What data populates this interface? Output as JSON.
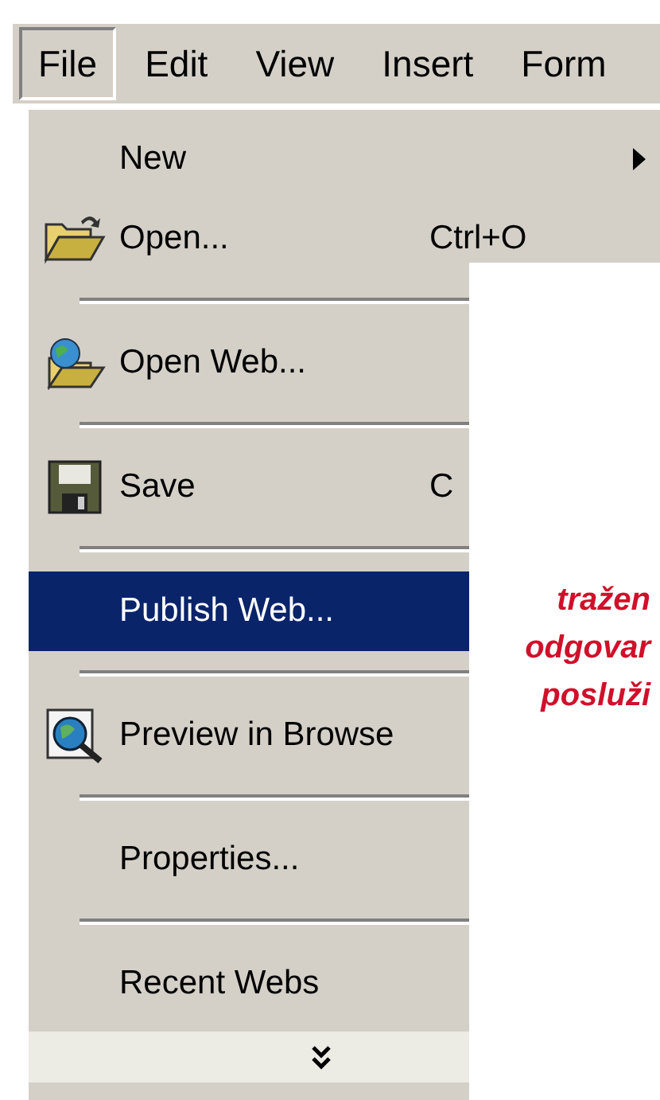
{
  "menu_bar": [
    {
      "label": "File",
      "selected": true
    },
    {
      "label": "Edit",
      "selected": false
    },
    {
      "label": "View",
      "selected": false
    },
    {
      "label": "Insert",
      "selected": false
    },
    {
      "label": "Form",
      "selected": false
    }
  ],
  "file_menu": {
    "items": [
      {
        "kind": "item",
        "label": "New",
        "submenu": true,
        "selected": false
      },
      {
        "kind": "item",
        "label": "Open...",
        "shortcut": "Ctrl+O",
        "selected": false
      },
      {
        "kind": "separator"
      },
      {
        "kind": "item",
        "label": "Open Web...",
        "selected": false
      },
      {
        "kind": "separator"
      },
      {
        "kind": "item",
        "label": "Save",
        "shortcut": "C",
        "selected": false
      },
      {
        "kind": "separator"
      },
      {
        "kind": "item",
        "label": "Publish Web...",
        "selected": true
      },
      {
        "kind": "separator"
      },
      {
        "kind": "item",
        "label": "Preview in Browse",
        "selected": false
      },
      {
        "kind": "separator"
      },
      {
        "kind": "item",
        "label": "Properties...",
        "selected": false
      },
      {
        "kind": "separator"
      },
      {
        "kind": "item",
        "label": "Recent Webs",
        "selected": false
      }
    ],
    "expand": true
  },
  "callout": {
    "lines": [
      "tražen",
      "odgovar",
      "posluži"
    ]
  }
}
